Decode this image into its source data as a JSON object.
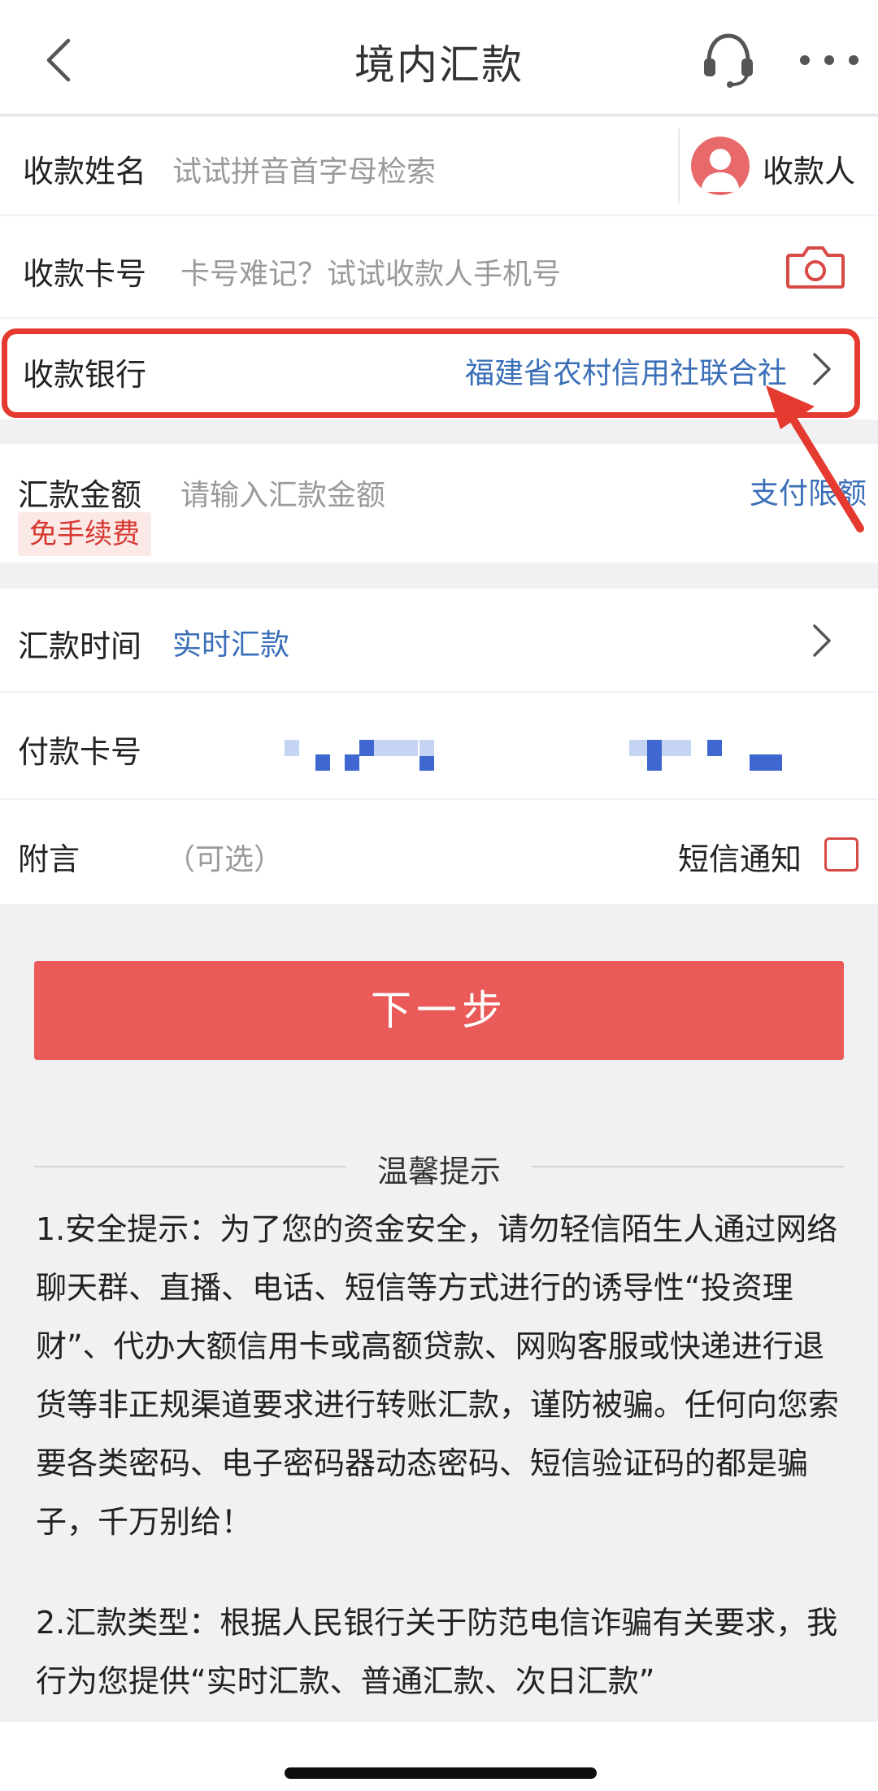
{
  "header": {
    "title": "境内汇款",
    "back_icon": "chevron-left-icon",
    "service_icon": "headset-icon",
    "more_icon": "more-dots-icon"
  },
  "form": {
    "payee_name": {
      "label": "收款姓名",
      "placeholder": "试试拼音首字母检索",
      "contact_button": "收款人",
      "contact_icon": "user-avatar-icon"
    },
    "card_number": {
      "label": "收款卡号",
      "placeholder": "卡号难记？试试收款人手机号",
      "scan_icon": "camera-icon"
    },
    "bank": {
      "label": "收款银行",
      "value": "福建省农村信用社联合社"
    },
    "amount": {
      "label": "汇款金额",
      "placeholder": "请输入汇款金额",
      "limit_link": "支付限额",
      "fee_badge": "免手续费"
    },
    "time": {
      "label": "汇款时间",
      "value": "实时汇款"
    },
    "pay_card": {
      "label": "付款卡号"
    },
    "note": {
      "label": "附言",
      "placeholder": "（可选）",
      "sms_label": "短信通知",
      "sms_checked": false
    }
  },
  "next_button": "下一步",
  "tips": {
    "title": "温馨提示",
    "items": [
      "1.安全提示：为了您的资金安全，请勿轻信陌生人通过网络聊天群、直播、电话、短信等方式进行的诱导性“投资理财”、代办大额信用卡或高额贷款、网购客服或快递进行退货等非正规渠道要求进行转账汇款，谨防被骗。任何向您索要各类密码、电子密码器动态密码、短信验证码的都是骗子，千万别给！",
      "2.汇款类型：根据人民银行关于防范电信诈骗有关要求，我行为您提供“实时汇款、普通汇款、次日汇款”"
    ]
  },
  "colors": {
    "primary_button": "#e95a59",
    "link_blue": "#3a6fb8",
    "highlight_red": "#e53a2f"
  }
}
